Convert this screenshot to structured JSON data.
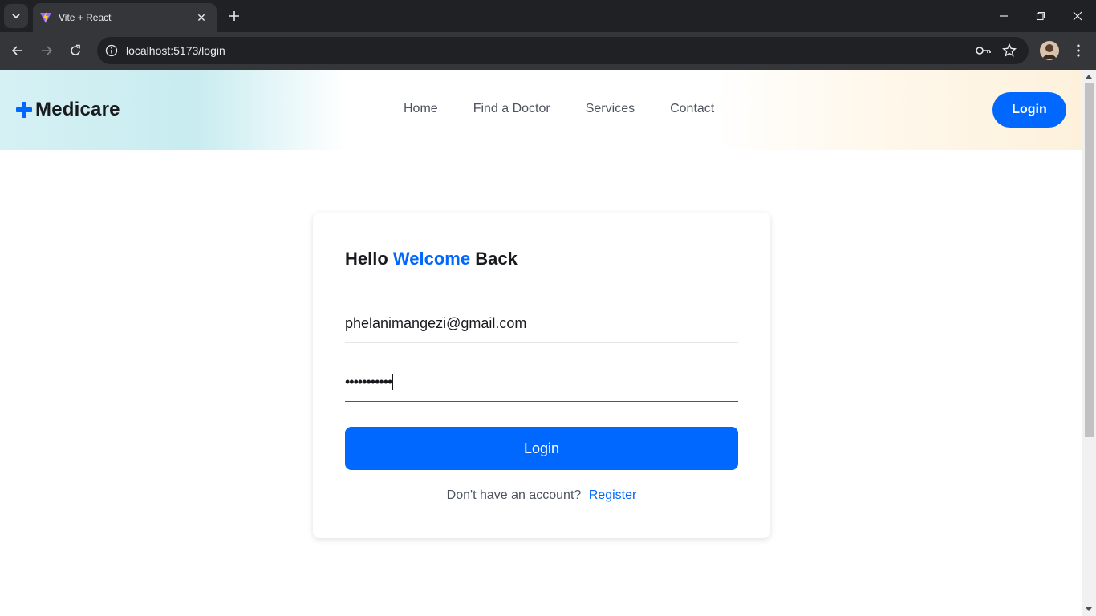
{
  "browser": {
    "tab_title": "Vite + React",
    "url": "localhost:5173/login"
  },
  "header": {
    "logo_text": "Medicare",
    "nav": [
      "Home",
      "Find a Doctor",
      "Services",
      "Contact"
    ],
    "login_label": "Login"
  },
  "login": {
    "title_part1": "Hello",
    "title_accent": "Welcome",
    "title_part3": "Back",
    "email_value": "phelanimangezi@gmail.com",
    "password_masked": "•••••••••••",
    "submit_label": "Login",
    "register_prompt": "Don't have an account?",
    "register_link": "Register"
  },
  "colors": {
    "brand": "#0067ff",
    "heading": "#181a1e",
    "text": "#4e545f"
  }
}
